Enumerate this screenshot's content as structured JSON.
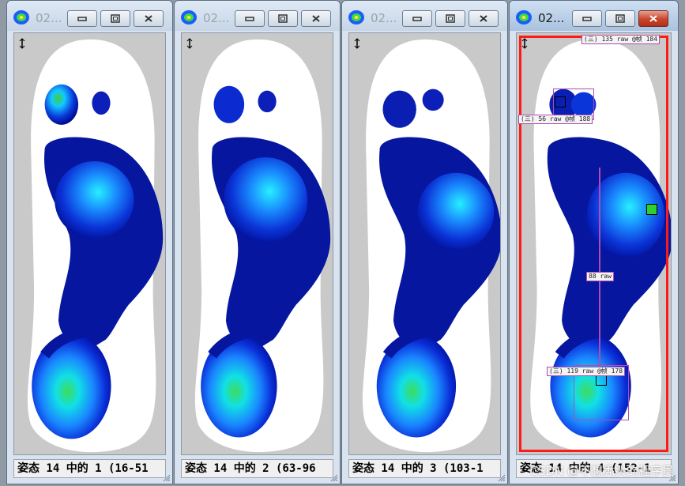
{
  "windows": [
    {
      "title": "02...",
      "status": "姿态 14 中的 1 (16-51",
      "active": false
    },
    {
      "title": "02...",
      "status": "姿态 14 中的 2 (63-96",
      "active": false
    },
    {
      "title": "02...",
      "status": "姿态 14 中的 3 (103-1",
      "active": false
    },
    {
      "title": "02...",
      "status": "姿态 14 中的 4 (152-1",
      "active": true,
      "annotations": {
        "top_label": "(三) 135 raw @帧 184",
        "toe_label": "(三) 56 raw @帧 188",
        "mid_label": "88 raw",
        "heel_label": "(三) 119 raw @帧 178"
      }
    }
  ],
  "watermark": "CSDN @不想秃头的程序员",
  "colors": {
    "accent_red": "#ff1a1a",
    "annotation": "#b04cb0",
    "pressure_low": "#00008b",
    "pressure_high": "#33cc33"
  },
  "icons": [
    "app-icon",
    "minimize-icon",
    "maximize-icon",
    "close-icon",
    "resize-arrow-icon",
    "size-grip-icon"
  ]
}
